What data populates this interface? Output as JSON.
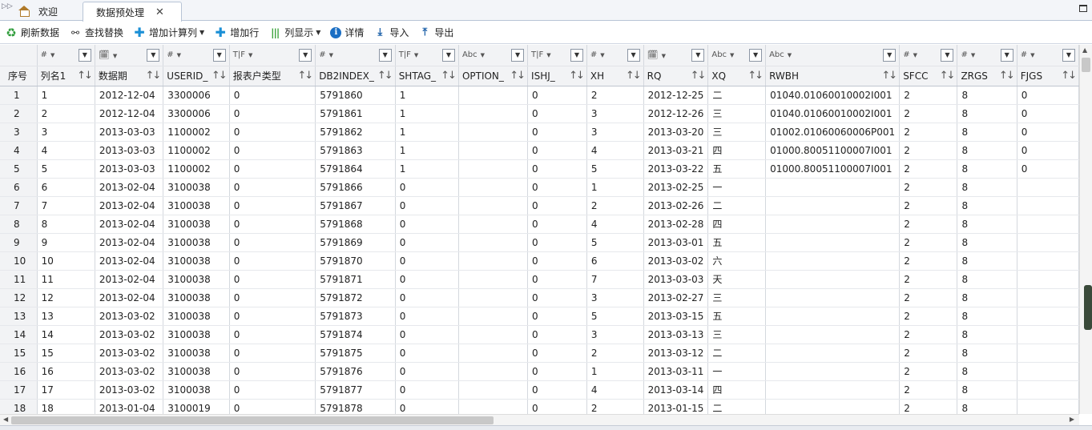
{
  "tabs": [
    {
      "label": "欢迎",
      "icon": "home-icon"
    },
    {
      "label": "数据预处理",
      "icon": "close-icon",
      "close": "✕"
    }
  ],
  "toolbar": {
    "refresh": "刷新数据",
    "find_replace": "查找替换",
    "add_calc_column": "增加计算列",
    "add_row": "增加行",
    "column_display": "列显示",
    "details": "详情",
    "import": "导入",
    "export": "导出"
  },
  "grid": {
    "row_header": "序号",
    "columns": [
      {
        "type": "#",
        "name": "列名1",
        "icon": "number-type-icon"
      },
      {
        "type": "date",
        "name": "数据期",
        "icon": "date-type-icon"
      },
      {
        "type": "#",
        "name": "USERID_",
        "icon": "number-type-icon"
      },
      {
        "type": "T|F",
        "name": "报表户类型",
        "icon": "boolean-type-icon"
      },
      {
        "type": "#",
        "name": "DB2INDEX_",
        "icon": "number-type-icon"
      },
      {
        "type": "T|F",
        "name": "SHTAG_",
        "icon": "boolean-type-icon"
      },
      {
        "type": "Abc",
        "name": "OPTION_",
        "icon": "text-type-icon"
      },
      {
        "type": "T|F",
        "name": "ISHJ_",
        "icon": "boolean-type-icon"
      },
      {
        "type": "#",
        "name": "XH",
        "icon": "number-type-icon"
      },
      {
        "type": "date",
        "name": "RQ",
        "icon": "date-type-icon"
      },
      {
        "type": "Abc",
        "name": "XQ",
        "icon": "text-type-icon"
      },
      {
        "type": "Abc",
        "name": "RWBH",
        "icon": "text-type-icon"
      },
      {
        "type": "#",
        "name": "SFCC",
        "icon": "number-type-icon"
      },
      {
        "type": "#",
        "name": "ZRGS",
        "icon": "number-type-icon"
      },
      {
        "type": "#",
        "name": "FJGS",
        "icon": "number-type-icon"
      }
    ],
    "rows": [
      [
        "1",
        "1",
        "2012-12-04",
        "3300006",
        "0",
        "5791860",
        "1",
        "",
        "0",
        "2",
        "2012-12-25",
        "二",
        "01040.01060010002I001",
        "2",
        "8",
        "0"
      ],
      [
        "2",
        "2",
        "2012-12-04",
        "3300006",
        "0",
        "5791861",
        "1",
        "",
        "0",
        "3",
        "2012-12-26",
        "三",
        "01040.01060010002I001",
        "2",
        "8",
        "0"
      ],
      [
        "3",
        "3",
        "2013-03-03",
        "1100002",
        "0",
        "5791862",
        "1",
        "",
        "0",
        "3",
        "2013-03-20",
        "三",
        "01002.01060060006P001",
        "2",
        "8",
        "0"
      ],
      [
        "4",
        "4",
        "2013-03-03",
        "1100002",
        "0",
        "5791863",
        "1",
        "",
        "0",
        "4",
        "2013-03-21",
        "四",
        "01000.80051100007I001",
        "2",
        "8",
        "0"
      ],
      [
        "5",
        "5",
        "2013-03-03",
        "1100002",
        "0",
        "5791864",
        "1",
        "",
        "0",
        "5",
        "2013-03-22",
        "五",
        "01000.80051100007I001",
        "2",
        "8",
        "0"
      ],
      [
        "6",
        "6",
        "2013-02-04",
        "3100038",
        "0",
        "5791866",
        "0",
        "",
        "0",
        "1",
        "2013-02-25",
        "一",
        "",
        "2",
        "8",
        ""
      ],
      [
        "7",
        "7",
        "2013-02-04",
        "3100038",
        "0",
        "5791867",
        "0",
        "",
        "0",
        "2",
        "2013-02-26",
        "二",
        "",
        "2",
        "8",
        ""
      ],
      [
        "8",
        "8",
        "2013-02-04",
        "3100038",
        "0",
        "5791868",
        "0",
        "",
        "0",
        "4",
        "2013-02-28",
        "四",
        "",
        "2",
        "8",
        ""
      ],
      [
        "9",
        "9",
        "2013-02-04",
        "3100038",
        "0",
        "5791869",
        "0",
        "",
        "0",
        "5",
        "2013-03-01",
        "五",
        "",
        "2",
        "8",
        ""
      ],
      [
        "10",
        "10",
        "2013-02-04",
        "3100038",
        "0",
        "5791870",
        "0",
        "",
        "0",
        "6",
        "2013-03-02",
        "六",
        "",
        "2",
        "8",
        ""
      ],
      [
        "11",
        "11",
        "2013-02-04",
        "3100038",
        "0",
        "5791871",
        "0",
        "",
        "0",
        "7",
        "2013-03-03",
        "天",
        "",
        "2",
        "8",
        ""
      ],
      [
        "12",
        "12",
        "2013-02-04",
        "3100038",
        "0",
        "5791872",
        "0",
        "",
        "0",
        "3",
        "2013-02-27",
        "三",
        "",
        "2",
        "8",
        ""
      ],
      [
        "13",
        "13",
        "2013-03-02",
        "3100038",
        "0",
        "5791873",
        "0",
        "",
        "0",
        "5",
        "2013-03-15",
        "五",
        "",
        "2",
        "8",
        ""
      ],
      [
        "14",
        "14",
        "2013-03-02",
        "3100038",
        "0",
        "5791874",
        "0",
        "",
        "0",
        "3",
        "2013-03-13",
        "三",
        "",
        "2",
        "8",
        ""
      ],
      [
        "15",
        "15",
        "2013-03-02",
        "3100038",
        "0",
        "5791875",
        "0",
        "",
        "0",
        "2",
        "2013-03-12",
        "二",
        "",
        "2",
        "8",
        ""
      ],
      [
        "16",
        "16",
        "2013-03-02",
        "3100038",
        "0",
        "5791876",
        "0",
        "",
        "0",
        "1",
        "2013-03-11",
        "一",
        "",
        "2",
        "8",
        ""
      ],
      [
        "17",
        "17",
        "2013-03-02",
        "3100038",
        "0",
        "5791877",
        "0",
        "",
        "0",
        "4",
        "2013-03-14",
        "四",
        "",
        "2",
        "8",
        ""
      ],
      [
        "18",
        "18",
        "2013-01-04",
        "3100019",
        "0",
        "5791878",
        "0",
        "",
        "0",
        "2",
        "2013-01-15",
        "二",
        "",
        "2",
        "8",
        ""
      ]
    ]
  }
}
